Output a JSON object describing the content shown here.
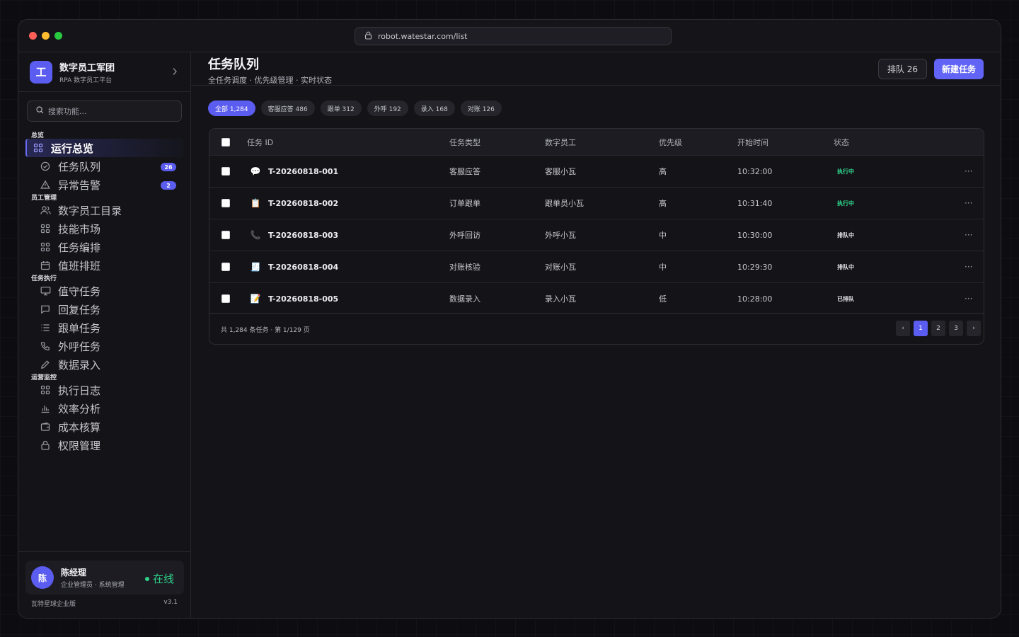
{
  "browser": {
    "url": "robot.watestar.com/list",
    "traffic_colors": [
      "#ff5f57",
      "#febc2e",
      "#28c840"
    ]
  },
  "brand": {
    "logo_char": "工",
    "name": "数字员工军团",
    "subtitle": "RPA 数字员工平台"
  },
  "search": {
    "placeholder": "搜索功能..."
  },
  "nav": {
    "sections": [
      {
        "label": "总览",
        "items": [
          {
            "label": "运行总览",
            "icon": "grid-icon",
            "active": true
          },
          {
            "label": "任务队列",
            "icon": "check-circle-icon",
            "badge": "26"
          },
          {
            "label": "异常告警",
            "icon": "warning-icon",
            "badge": "2"
          }
        ]
      },
      {
        "label": "员工管理",
        "items": [
          {
            "label": "数字员工目录",
            "icon": "users-icon"
          },
          {
            "label": "技能市场",
            "icon": "grid-icon"
          },
          {
            "label": "任务编排",
            "icon": "grid-icon"
          },
          {
            "label": "值班排班",
            "icon": "calendar-icon"
          }
        ]
      },
      {
        "label": "任务执行",
        "items": [
          {
            "label": "值守任务",
            "icon": "monitor-icon"
          },
          {
            "label": "回复任务",
            "icon": "chat-icon"
          },
          {
            "label": "跟单任务",
            "icon": "list-icon"
          },
          {
            "label": "外呼任务",
            "icon": "phone-icon"
          },
          {
            "label": "数据录入",
            "icon": "pen-icon"
          }
        ]
      },
      {
        "label": "运营监控",
        "items": [
          {
            "label": "执行日志",
            "icon": "grid-icon"
          },
          {
            "label": "效率分析",
            "icon": "bar-chart-icon"
          },
          {
            "label": "成本核算",
            "icon": "wallet-icon"
          },
          {
            "label": "权限管理",
            "icon": "lock-icon"
          }
        ]
      }
    ]
  },
  "user": {
    "avatar_char": "陈",
    "name": "陈经理",
    "role": "企业管理员 · 系统管理",
    "status": "在线"
  },
  "footer": {
    "edition": "瓦特星球企业版",
    "version": "v3.1"
  },
  "header": {
    "title": "任务队列",
    "subtitle": "全任务调度 · 优先级管理 · 实时状态",
    "queue_button": "排队 26",
    "new_button": "新建任务"
  },
  "filters": [
    {
      "label": "全部 1,284",
      "active": true
    },
    {
      "label": "客服应答 486"
    },
    {
      "label": "跟单 312"
    },
    {
      "label": "外呼 192"
    },
    {
      "label": "录入 168"
    },
    {
      "label": "对账 126"
    }
  ],
  "table": {
    "columns": [
      "任务 ID",
      "任务类型",
      "数字员工",
      "优先级",
      "开始时间",
      "状态"
    ],
    "rows": [
      {
        "id": "T-20260818-001",
        "icon": "💬",
        "icon_name": "speech-bubble-icon",
        "type": "客服应答",
        "worker": "客服小瓦",
        "priority": "高",
        "start": "10:32:00",
        "status": "执行中",
        "status_kind": "run"
      },
      {
        "id": "T-20260818-002",
        "icon": "📋",
        "icon_name": "clipboard-icon",
        "type": "订单跟单",
        "worker": "跟单员小瓦",
        "priority": "高",
        "start": "10:31:40",
        "status": "执行中",
        "status_kind": "run"
      },
      {
        "id": "T-20260818-003",
        "icon": "📞",
        "icon_name": "phone-receiver-icon",
        "type": "外呼回访",
        "worker": "外呼小瓦",
        "priority": "中",
        "start": "10:30:00",
        "status": "排队中",
        "status_kind": "queue"
      },
      {
        "id": "T-20260818-004",
        "icon": "🧾",
        "icon_name": "receipt-icon",
        "type": "对账核验",
        "worker": "对账小瓦",
        "priority": "中",
        "start": "10:29:30",
        "status": "排队中",
        "status_kind": "queue"
      },
      {
        "id": "T-20260818-005",
        "icon": "📝",
        "icon_name": "memo-icon",
        "type": "数据录入",
        "worker": "录入小瓦",
        "priority": "低",
        "start": "10:28:00",
        "status": "已排队",
        "status_kind": "queue"
      }
    ],
    "more_label": "···",
    "summary": "共 1,284 条任务 · 第 1/129 页",
    "pager": [
      "‹",
      "1",
      "2",
      "3",
      "›"
    ],
    "current_page": "1"
  },
  "colors": {
    "accent": "#5b5cf0",
    "running": "#2fd28a",
    "online": "#2fd28a"
  }
}
